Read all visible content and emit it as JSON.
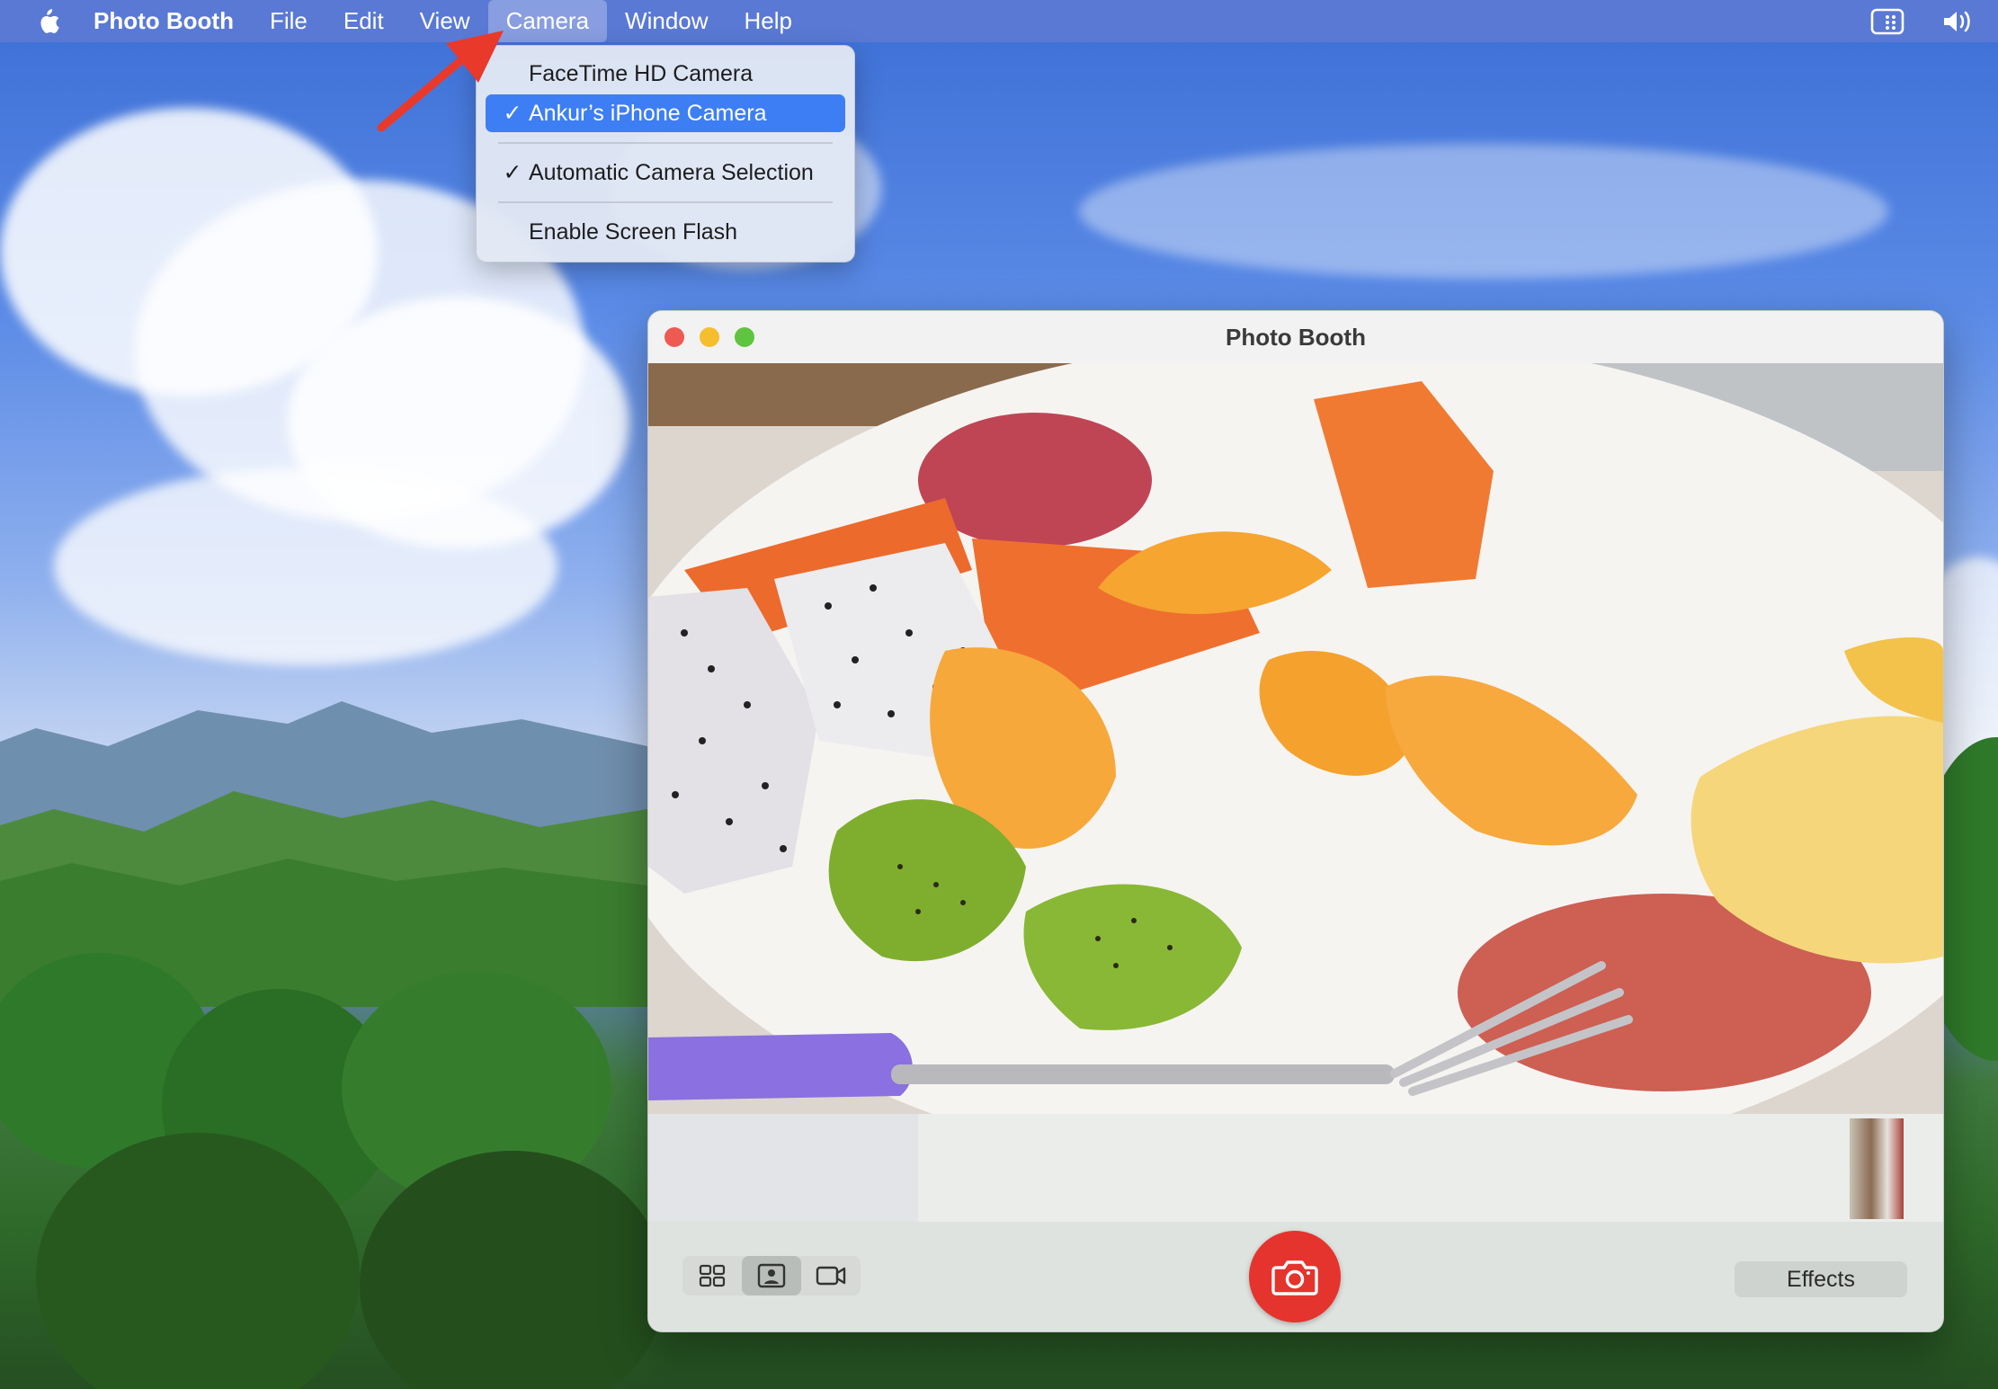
{
  "menubar": {
    "app_name": "Photo Booth",
    "menus": [
      "File",
      "Edit",
      "View",
      "Camera",
      "Window",
      "Help"
    ],
    "active_menu": "Camera"
  },
  "camera_menu": {
    "items": [
      {
        "label": "FaceTime HD Camera",
        "checked": false,
        "selected": false
      },
      {
        "label": "Ankur’s iPhone Camera",
        "checked": true,
        "selected": true
      },
      {
        "label": "Automatic Camera Selection",
        "checked": true,
        "selected": false
      },
      {
        "label": "Enable Screen Flash",
        "checked": false,
        "selected": false
      }
    ],
    "check_glyph": "✓"
  },
  "window": {
    "title": "Photo Booth",
    "effects_label": "Effects",
    "view_modes": [
      "grid-icon",
      "portrait-icon",
      "video-icon"
    ],
    "active_view_mode": "portrait-icon"
  },
  "colors": {
    "menubar": "#5c7ad4",
    "selection": "#3d7ef5",
    "shutter": "#e5342d",
    "arrow": "#e8392b"
  }
}
